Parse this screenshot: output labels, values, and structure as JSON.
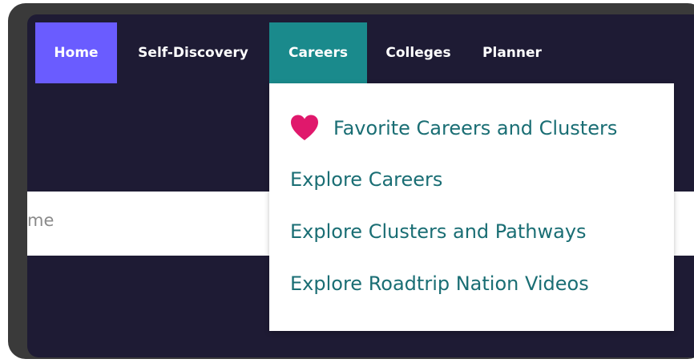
{
  "nav": {
    "home": "Home",
    "self_discovery": "Self-Discovery",
    "careers": "Careers",
    "colleges": "Colleges",
    "planner": "Planner"
  },
  "search": {
    "partial_text": "me"
  },
  "careers_menu": {
    "items": [
      {
        "label": "Favorite Careers and Clusters",
        "icon": "heart-icon"
      },
      {
        "label": "Explore Careers"
      },
      {
        "label": "Explore Clusters and Pathways"
      },
      {
        "label": "Explore Roadtrip Nation Videos"
      }
    ]
  },
  "colors": {
    "home_active": "#6a5cff",
    "careers_active": "#1a8a8c",
    "nav_bg": "#1e1b34",
    "menu_text": "#1a6e74",
    "heart": "#e0186c"
  }
}
